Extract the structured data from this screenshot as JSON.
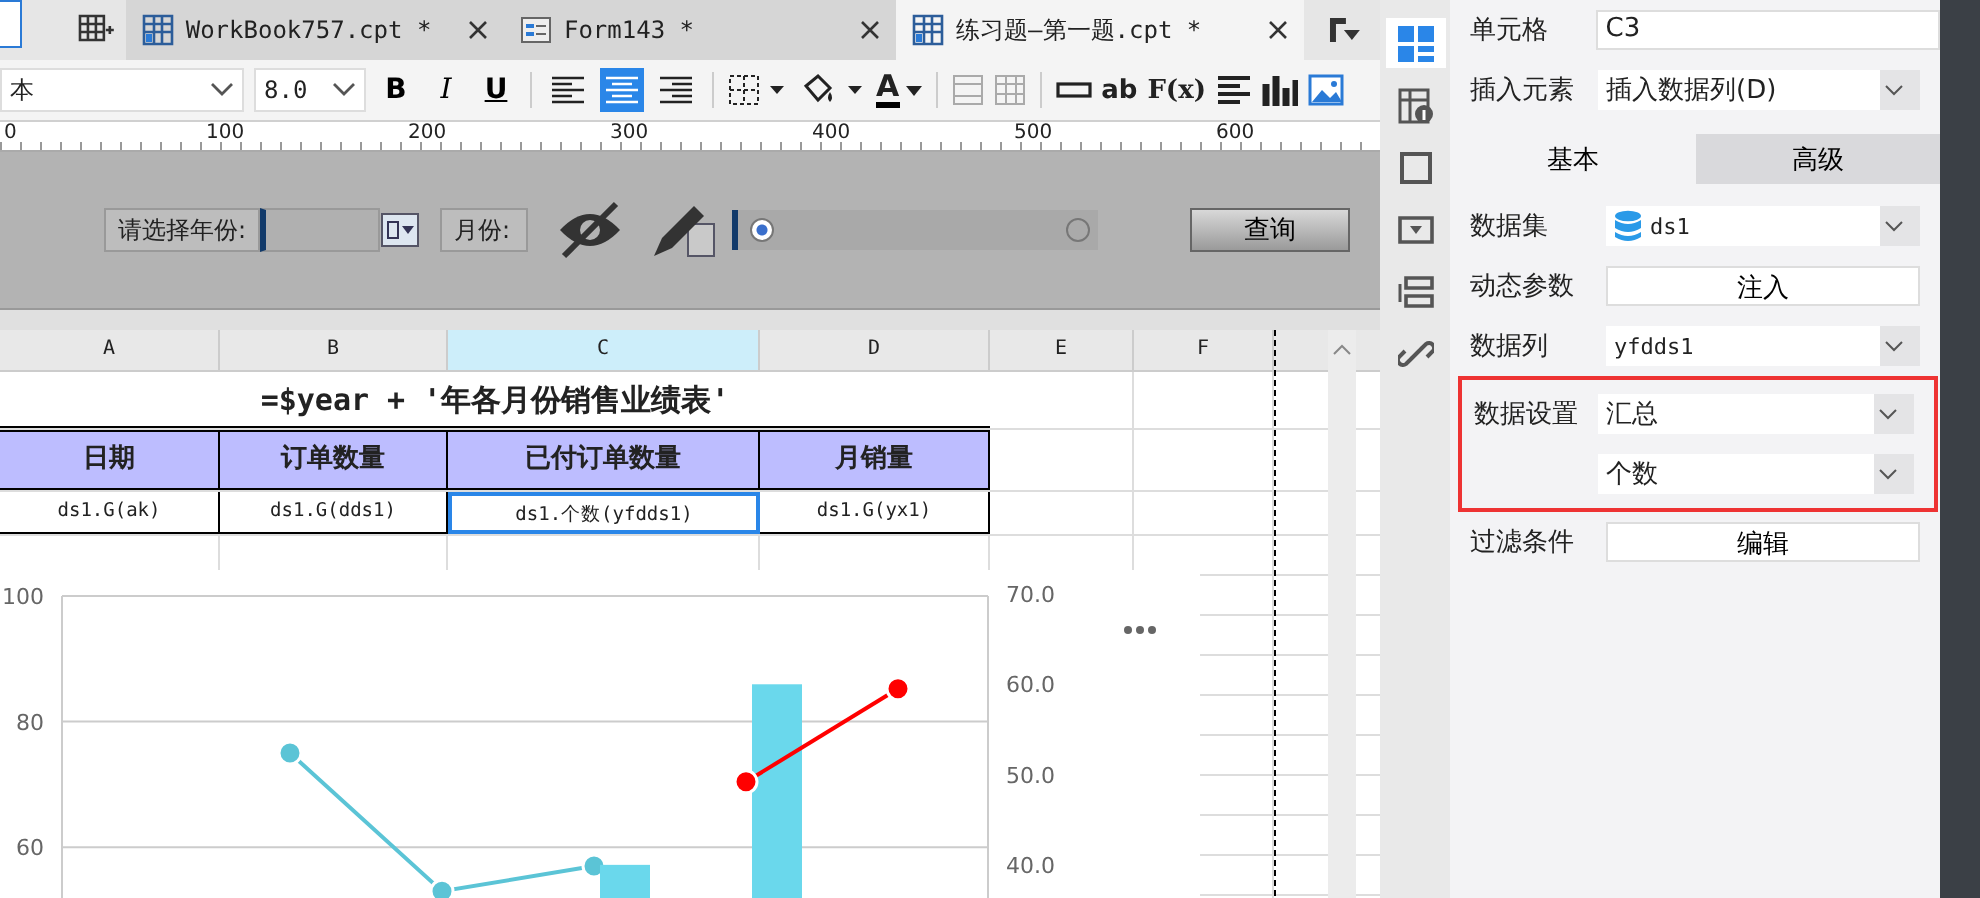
{
  "tabs": [
    {
      "label": "WorkBook757.cpt *",
      "kind": "workbook",
      "selected": false
    },
    {
      "label": "Form143 *",
      "kind": "form",
      "selected": false
    },
    {
      "label": "练习题—第一题.cpt *",
      "kind": "workbook",
      "selected": true
    }
  ],
  "toolbar": {
    "font": "本",
    "font_size": "8.0",
    "styles": [
      "B",
      "I",
      "U"
    ],
    "alignments": [
      {
        "kind": "left",
        "selected": false
      },
      {
        "kind": "center",
        "selected": true
      },
      {
        "kind": "right",
        "selected": false
      }
    ],
    "font_color_glyph": "A",
    "glyphs": [
      "ab",
      "F(x)"
    ]
  },
  "ruler": {
    "ticks": [
      "0",
      "100",
      "200",
      "300",
      "400",
      "500",
      "600"
    ]
  },
  "parameters": {
    "year_label": "请选择年份:",
    "month_label": "月份:",
    "query_button": "查询",
    "radios": [
      {
        "selected": true
      },
      {
        "selected": false
      }
    ]
  },
  "sheet": {
    "columns": [
      {
        "label": "A",
        "selected": false
      },
      {
        "label": "B",
        "selected": false
      },
      {
        "label": "C",
        "selected": true
      },
      {
        "label": "D",
        "selected": false
      },
      {
        "label": "E",
        "selected": false
      },
      {
        "label": "F",
        "selected": false
      }
    ],
    "title": "=$year + '年各月份销售业绩表'",
    "headers": [
      "日期",
      "订单数量",
      "已付订单数量",
      "月销量"
    ],
    "cells": [
      {
        "text": "ds1.G(ak)",
        "selected": false
      },
      {
        "text": "ds1.G(dds1)",
        "selected": false
      },
      {
        "text": "ds1.个数(yfdds1)",
        "selected": true
      },
      {
        "text": "ds1.G(yx1)",
        "selected": false
      }
    ],
    "chart_data": {
      "type": "line",
      "ylim": [
        50,
        100
      ],
      "yticks": [
        60,
        80,
        100
      ],
      "y2lim": [
        35,
        70
      ],
      "y2ticks": [
        {
          "value": 40,
          "label": "40.0"
        },
        {
          "value": 50,
          "label": "50.0"
        },
        {
          "value": 60,
          "label": "60.0"
        },
        {
          "value": 70,
          "label": "70.0"
        }
      ],
      "series": [
        {
          "color": "#5bc4d6",
          "marker": true,
          "values": [
            null,
            75,
            53,
            57,
            null,
            null
          ]
        },
        {
          "type": "bar",
          "axis": "y2",
          "color": "#6ad8ec",
          "values": [
            null,
            null,
            null,
            40,
            60,
            null
          ]
        },
        {
          "axis": "y2",
          "color": "#ff0000",
          "marker": true,
          "values": [
            null,
            null,
            null,
            null,
            49.2,
            59.5
          ]
        }
      ]
    }
  },
  "side_icons": [
    {
      "kind": "cell",
      "selected": true
    },
    {
      "kind": "info",
      "selected": false
    },
    {
      "kind": "frame",
      "selected": false
    },
    {
      "kind": "widget",
      "selected": false
    },
    {
      "kind": "condition",
      "selected": false
    },
    {
      "kind": "link",
      "selected": false
    }
  ],
  "panel": {
    "cell_label": "单元格",
    "cell_value": "C3",
    "insert_label": "插入元素",
    "insert_value": "插入数据列(D)",
    "tabs": [
      {
        "label": "基本",
        "selected": true
      },
      {
        "label": "高级",
        "selected": false
      }
    ],
    "rows": [
      {
        "label": "数据集",
        "kind": "dataset",
        "value": "ds1",
        "highlighted": false
      },
      {
        "label": "动态参数",
        "kind": "button",
        "value": "注入",
        "highlighted": false
      },
      {
        "label": "数据列",
        "kind": "select",
        "value": "yfdds1",
        "highlighted": false
      },
      {
        "label": "数据设置",
        "kind": "select",
        "value": "汇总",
        "highlighted": true
      },
      {
        "kind": "select",
        "value": "个数",
        "highlighted": true
      },
      {
        "label": "过滤条件",
        "kind": "button",
        "value": "编辑",
        "highlighted": false
      }
    ]
  }
}
